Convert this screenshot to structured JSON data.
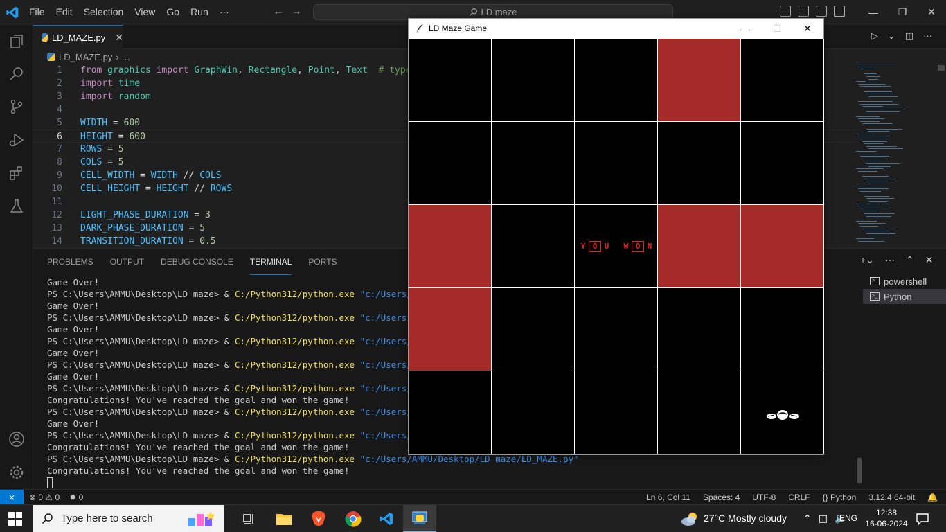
{
  "menu": [
    "File",
    "Edit",
    "Selection",
    "View",
    "Go",
    "Run",
    "···"
  ],
  "search_center": {
    "text": "LD maze"
  },
  "tab": {
    "label": "LD_MAZE.py"
  },
  "breadcrumb": {
    "file": "LD_MAZE.py",
    "sep": "› …"
  },
  "code": {
    "current_line": 6,
    "lines": [
      {
        "n": "1",
        "text": "from graphics import GraphWin, Rectangle, Point, Text  # type"
      },
      {
        "n": "2",
        "text": "import time"
      },
      {
        "n": "3",
        "text": "import random"
      },
      {
        "n": "4",
        "text": ""
      },
      {
        "n": "5",
        "text": "WIDTH = 600"
      },
      {
        "n": "6",
        "text": "HEIGHT = 600"
      },
      {
        "n": "7",
        "text": "ROWS = 5"
      },
      {
        "n": "8",
        "text": "COLS = 5"
      },
      {
        "n": "9",
        "text": "CELL_WIDTH = WIDTH // COLS"
      },
      {
        "n": "10",
        "text": "CELL_HEIGHT = HEIGHT // ROWS"
      },
      {
        "n": "11",
        "text": ""
      },
      {
        "n": "12",
        "text": "LIGHT_PHASE_DURATION = 3"
      },
      {
        "n": "13",
        "text": "DARK_PHASE_DURATION = 5"
      },
      {
        "n": "14",
        "text": "TRANSITION_DURATION = 0.5"
      }
    ]
  },
  "panel": {
    "tabs": [
      "PROBLEMS",
      "OUTPUT",
      "DEBUG CONSOLE",
      "TERMINAL",
      "PORTS"
    ],
    "active_tab": "TERMINAL",
    "terminals": [
      "powershell",
      "Python"
    ],
    "active_terminal": "Python"
  },
  "terminal": {
    "prompt": "PS C:\\Users\\AMMU\\Desktop\\LD maze> ",
    "amp": "& ",
    "exe": "C:/Python312/python.exe",
    "arg_short": " \"c:/Users/AMMU/",
    "arg_full": " \"c:/Users/AMMU/Desktop/LD maze/LD_MAZE.py\"",
    "lines": [
      {
        "type": "out",
        "text": "Game Over!"
      },
      {
        "type": "cmd",
        "full": false
      },
      {
        "type": "out",
        "text": "Game Over!"
      },
      {
        "type": "cmd",
        "full": false
      },
      {
        "type": "out",
        "text": "Game Over!"
      },
      {
        "type": "cmd",
        "full": false
      },
      {
        "type": "out",
        "text": "Game Over!"
      },
      {
        "type": "cmd",
        "full": false
      },
      {
        "type": "out",
        "text": "Game Over!"
      },
      {
        "type": "cmd",
        "full": false
      },
      {
        "type": "out",
        "text": "Congratulations! You've reached the goal and won the game!"
      },
      {
        "type": "cmd",
        "full": false
      },
      {
        "type": "out",
        "text": "Game Over!"
      },
      {
        "type": "cmd",
        "full": false
      },
      {
        "type": "out",
        "text": "Congratulations! You've reached the goal and won the game!"
      },
      {
        "type": "cmd",
        "full": true
      },
      {
        "type": "out",
        "text": "Congratulations! You've reached the goal and won the game!"
      }
    ]
  },
  "status": {
    "errors": "0",
    "warnings": "0",
    "ports": "0",
    "position": "Ln 6, Col 11",
    "spaces": "Spaces: 4",
    "encoding": "UTF-8",
    "eol": "CRLF",
    "language": "Python",
    "interpreter": "3.12.4 64-bit"
  },
  "game": {
    "title": "LD Maze Game",
    "grid": [
      [
        0,
        0,
        0,
        1,
        0
      ],
      [
        0,
        0,
        0,
        0,
        0
      ],
      [
        1,
        0,
        0,
        1,
        1
      ],
      [
        1,
        0,
        0,
        0,
        0
      ],
      [
        0,
        0,
        0,
        0,
        0
      ]
    ],
    "message": "YOU WON",
    "colors": {
      "red": "#a52a2a",
      "dark": "#000000",
      "grid_line": "#ffffff",
      "message": "#ff1a1a"
    }
  },
  "taskbar": {
    "search_placeholder": "Type here to search",
    "weather": "27°C  Mostly cloudy",
    "lang": "ENG",
    "time": "12:38",
    "date": "16-06-2024"
  },
  "icons": {
    "activity": [
      "explorer-icon",
      "search-icon",
      "source-control-icon",
      "run-debug-icon",
      "extensions-icon",
      "testing-icon",
      "account-icon",
      "settings-icon"
    ],
    "taskbar": [
      "task-view-icon",
      "file-explorer-icon",
      "brave-icon",
      "chrome-icon",
      "vscode-icon",
      "python-icon"
    ]
  }
}
